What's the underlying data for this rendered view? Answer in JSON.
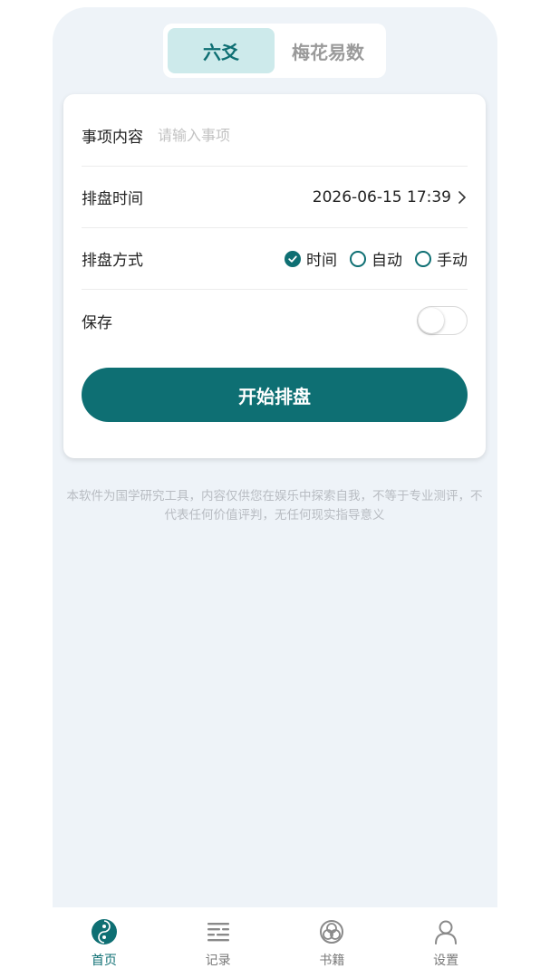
{
  "segment": {
    "tabs": [
      {
        "label": "六爻",
        "active": true
      },
      {
        "label": "梅花易数",
        "active": false
      }
    ]
  },
  "form": {
    "subject_label": "事项内容",
    "subject_placeholder": "请输入事项",
    "subject_value": "",
    "time_label": "排盘时间",
    "time_value": "2026-06-15 17:39",
    "method_label": "排盘方式",
    "method_options": [
      {
        "label": "时间",
        "checked": true
      },
      {
        "label": "自动",
        "checked": false
      },
      {
        "label": "手动",
        "checked": false
      }
    ],
    "save_label": "保存",
    "save_enabled": false,
    "start_button": "开始排盘"
  },
  "disclaimer": "本软件为国学研究工具，内容仅供您在娱乐中探索自我，不等于专业测评，不代表任何价值评判，无任何现实指导意义",
  "tabbar": {
    "items": [
      {
        "label": "首页",
        "icon": "taiji-icon",
        "active": true
      },
      {
        "label": "记录",
        "icon": "list-icon",
        "active": false
      },
      {
        "label": "书籍",
        "icon": "book-knot-icon",
        "active": false
      },
      {
        "label": "设置",
        "icon": "user-icon",
        "active": false
      }
    ]
  },
  "colors": {
    "accent": "#0e6f73",
    "accent_light": "#cdeaeb",
    "background": "#eef3f8"
  }
}
